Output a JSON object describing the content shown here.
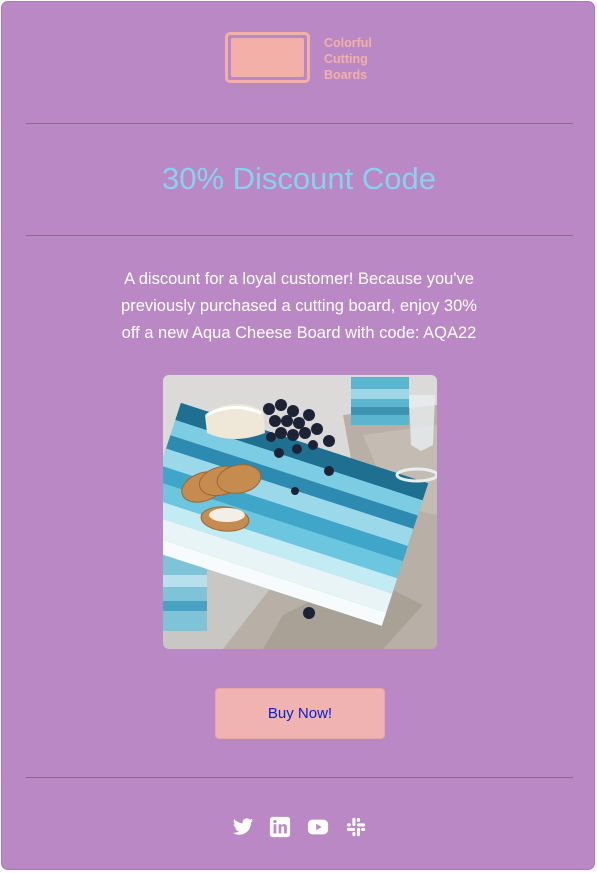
{
  "brand": {
    "logo_line1": "Colorful",
    "logo_line2": "Cutting",
    "logo_line3": "Boards",
    "logo_color": "#f3b0a9"
  },
  "email": {
    "title": "30% Discount Code",
    "body_line1": "A discount for a loyal customer! Because you've",
    "body_line2": "previously purchased a cutting board, enjoy 30%",
    "body_line3": "off a new Aqua Cheese Board with code: AQA22",
    "cta_label": "Buy Now!"
  },
  "social": [
    {
      "icon": "twitter-icon"
    },
    {
      "icon": "linkedin-icon"
    },
    {
      "icon": "youtube-icon"
    },
    {
      "icon": "slack-icon"
    }
  ],
  "colors": {
    "background": "#ba88c4",
    "title": "#8ad0f0",
    "button": "#f0b3b1",
    "button_text": "#0a20c8"
  }
}
